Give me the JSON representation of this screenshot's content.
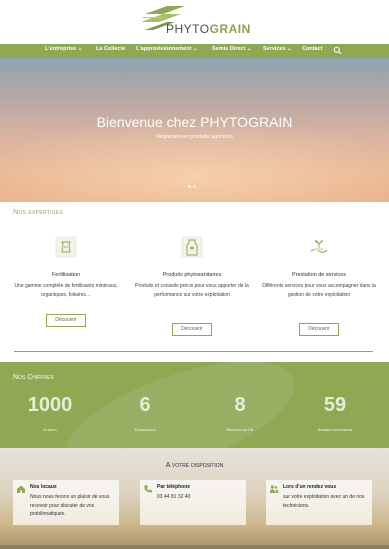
{
  "brand": {
    "prefix": "PHYTO",
    "suffix": "GRAIN"
  },
  "nav": {
    "items": [
      "L'entreprise",
      "La Collecte",
      "L'approvisionnement",
      "Semis Direct",
      "Services",
      "Contact"
    ],
    "search_icon": "search-icon"
  },
  "hero": {
    "title": "Bienvenue chez PHYTOGRAIN",
    "subtitle": "Négociant en produits agricoles"
  },
  "expertises": {
    "title": "Nos expertises",
    "cards": [
      {
        "icon": "fertilizer-bag-icon",
        "name": "Fertilisation",
        "desc": "Une gamme complète de fertilisants minéraux, organiques, foliaires…",
        "button": "Découvrir"
      },
      {
        "icon": "product-bottle-icon",
        "name": "Produits phytosanitaires",
        "desc": "Produits et conseils précis pour vous apporter de la performance sur votre exploitation",
        "button": "Découvrir"
      },
      {
        "icon": "hand-plant-icon",
        "name": "Prestation de services",
        "desc": "Différents services pour vous accompagner dans la gestion de votre exploitation",
        "button": "Découvrir"
      }
    ]
  },
  "stats": {
    "title": "Nos Chiffres",
    "items": [
      {
        "value": "1000",
        "label": "Clients"
      },
      {
        "value": "6",
        "label": "Techniciens"
      },
      {
        "value": "8",
        "label": "Millions de CA"
      },
      {
        "value": "59",
        "label": "Années d'existence"
      }
    ]
  },
  "contact": {
    "title": "A votre disposition",
    "boxes": [
      {
        "icon": "home-icon",
        "head": "Nos locaux",
        "text": "Nous nous ferons un plaisir de vous recevoir pour discuter de vos problématiques."
      },
      {
        "icon": "phone-icon",
        "head": "Par téléphone",
        "text": "03 44 81 32 40"
      },
      {
        "icon": "people-icon",
        "head": "Lors d'un rendez vous",
        "text": "sur votre exploitation avec un de nos techniciens."
      }
    ]
  },
  "colors": {
    "accent": "#8ea854",
    "white": "#ffffff"
  }
}
